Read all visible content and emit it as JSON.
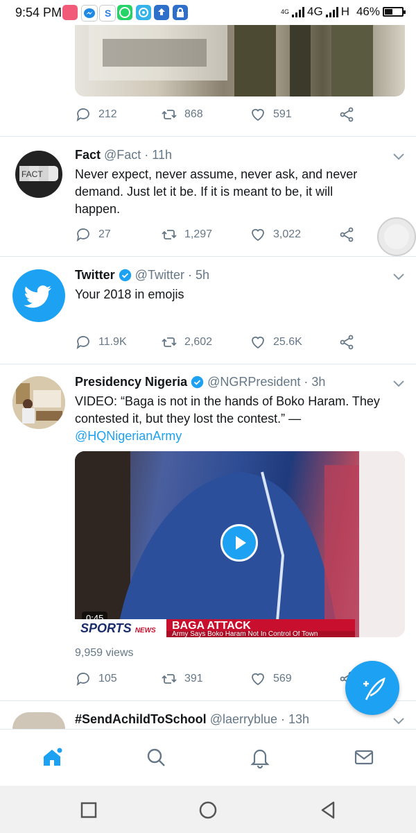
{
  "status_bar": {
    "time": "9:54 PM",
    "network_label_1": "4G",
    "network_label_2": "H",
    "network_small": "4G",
    "battery": "46%",
    "battery_level": 0.46
  },
  "tweets": [
    {
      "stats": {
        "replies": "212",
        "retweets": "868",
        "likes": "591"
      }
    },
    {
      "name": "Fact",
      "handle": "@Fact",
      "time": "· 11h",
      "avatar_text": "FACT",
      "text": "Never expect, never assume, never ask, and never demand. Just let it be. If it is meant to be, it will happen.",
      "stats": {
        "replies": "27",
        "retweets": "1,297",
        "likes": "3,022"
      }
    },
    {
      "name": "Twitter",
      "handle": "@Twitter",
      "time": "· 5h",
      "text": "Your 2018 in emojis",
      "stats": {
        "replies": "11.9K",
        "retweets": "2,602",
        "likes": "25.6K"
      }
    },
    {
      "name": "Presidency Nigeria",
      "handle": "@NGRPresident",
      "time": "· 3h",
      "text": "VIDEO: “Baga is not in the hands of Boko Haram. They contested it, but they lost the contest.” —",
      "mention": "@HQNigerianArmy",
      "video_duration": "0:45",
      "video_banner_left": "SPORTS",
      "video_banner_left2": "NEWS",
      "video_banner_title": "BAGA ATTACK",
      "video_banner_sub": "Army Says Boko Haram Not In Control Of Town",
      "views": "9,959 views",
      "stats": {
        "replies": "105",
        "retweets": "391",
        "likes": "569"
      }
    },
    {
      "name": "#SendAchildToSchool",
      "handle": "@laerryblue",
      "time": "· 13h"
    }
  ],
  "colors": {
    "accent": "#1da1f2",
    "secondary_text": "#657786"
  },
  "bottom_nav": [
    "home-icon",
    "search-icon",
    "notifications-icon",
    "messages-icon"
  ]
}
